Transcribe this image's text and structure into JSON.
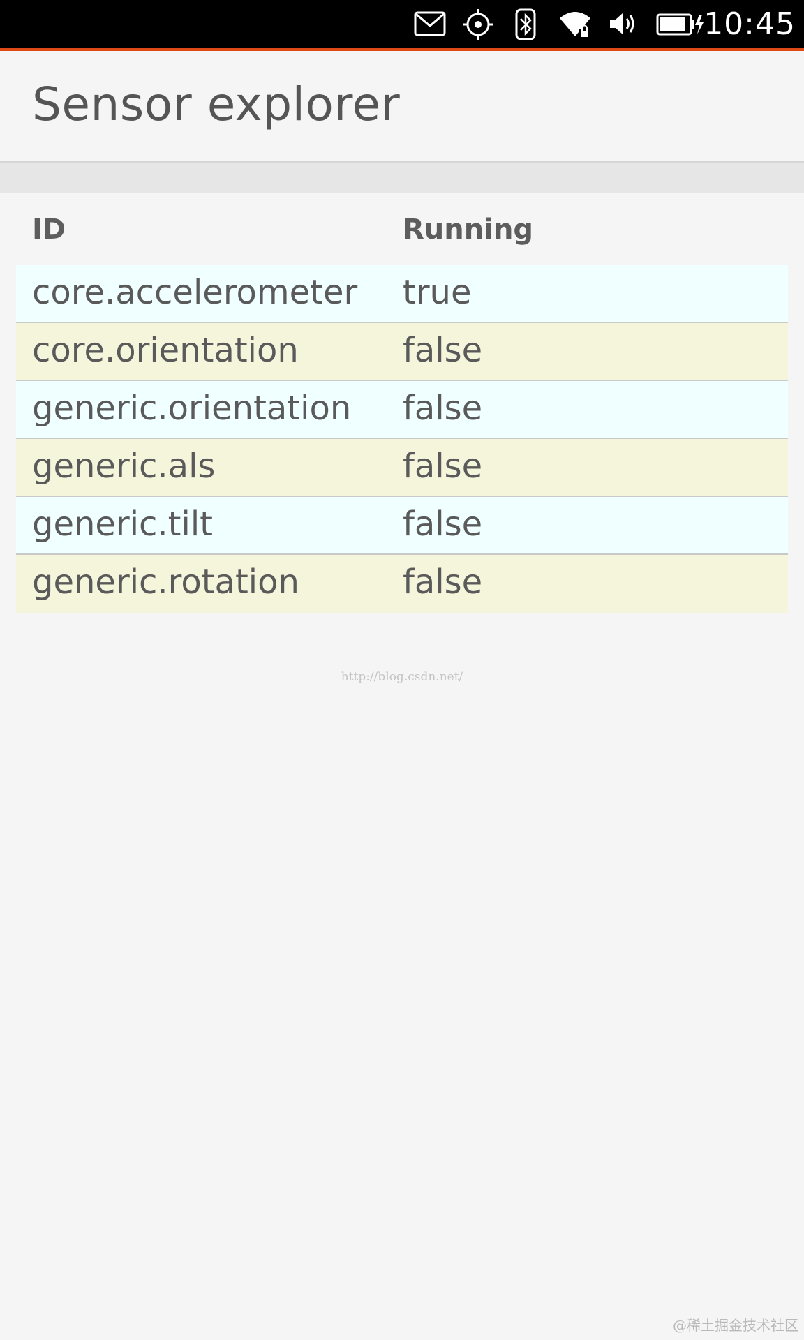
{
  "status_bar": {
    "time": "10:45",
    "icons": [
      "mail-icon",
      "location-icon",
      "bluetooth-icon",
      "wifi-locked-icon",
      "volume-icon",
      "battery-charging-icon"
    ]
  },
  "header": {
    "title": "Sensor explorer"
  },
  "table": {
    "columns": [
      "ID",
      "Running"
    ],
    "rows": [
      {
        "id": "core.accelerometer",
        "running": "true"
      },
      {
        "id": "core.orientation",
        "running": "false"
      },
      {
        "id": "generic.orientation",
        "running": "false"
      },
      {
        "id": "generic.als",
        "running": "false"
      },
      {
        "id": "generic.tilt",
        "running": "false"
      },
      {
        "id": "generic.rotation",
        "running": "false"
      }
    ]
  },
  "watermarks": {
    "url": "http://blog.csdn.net/",
    "corner": "@稀土掘金技术社区"
  },
  "colors": {
    "accent": "#dd4814",
    "row_even": "#f0ffff",
    "row_odd": "#f5f5dc",
    "text": "#5a5a5a"
  }
}
